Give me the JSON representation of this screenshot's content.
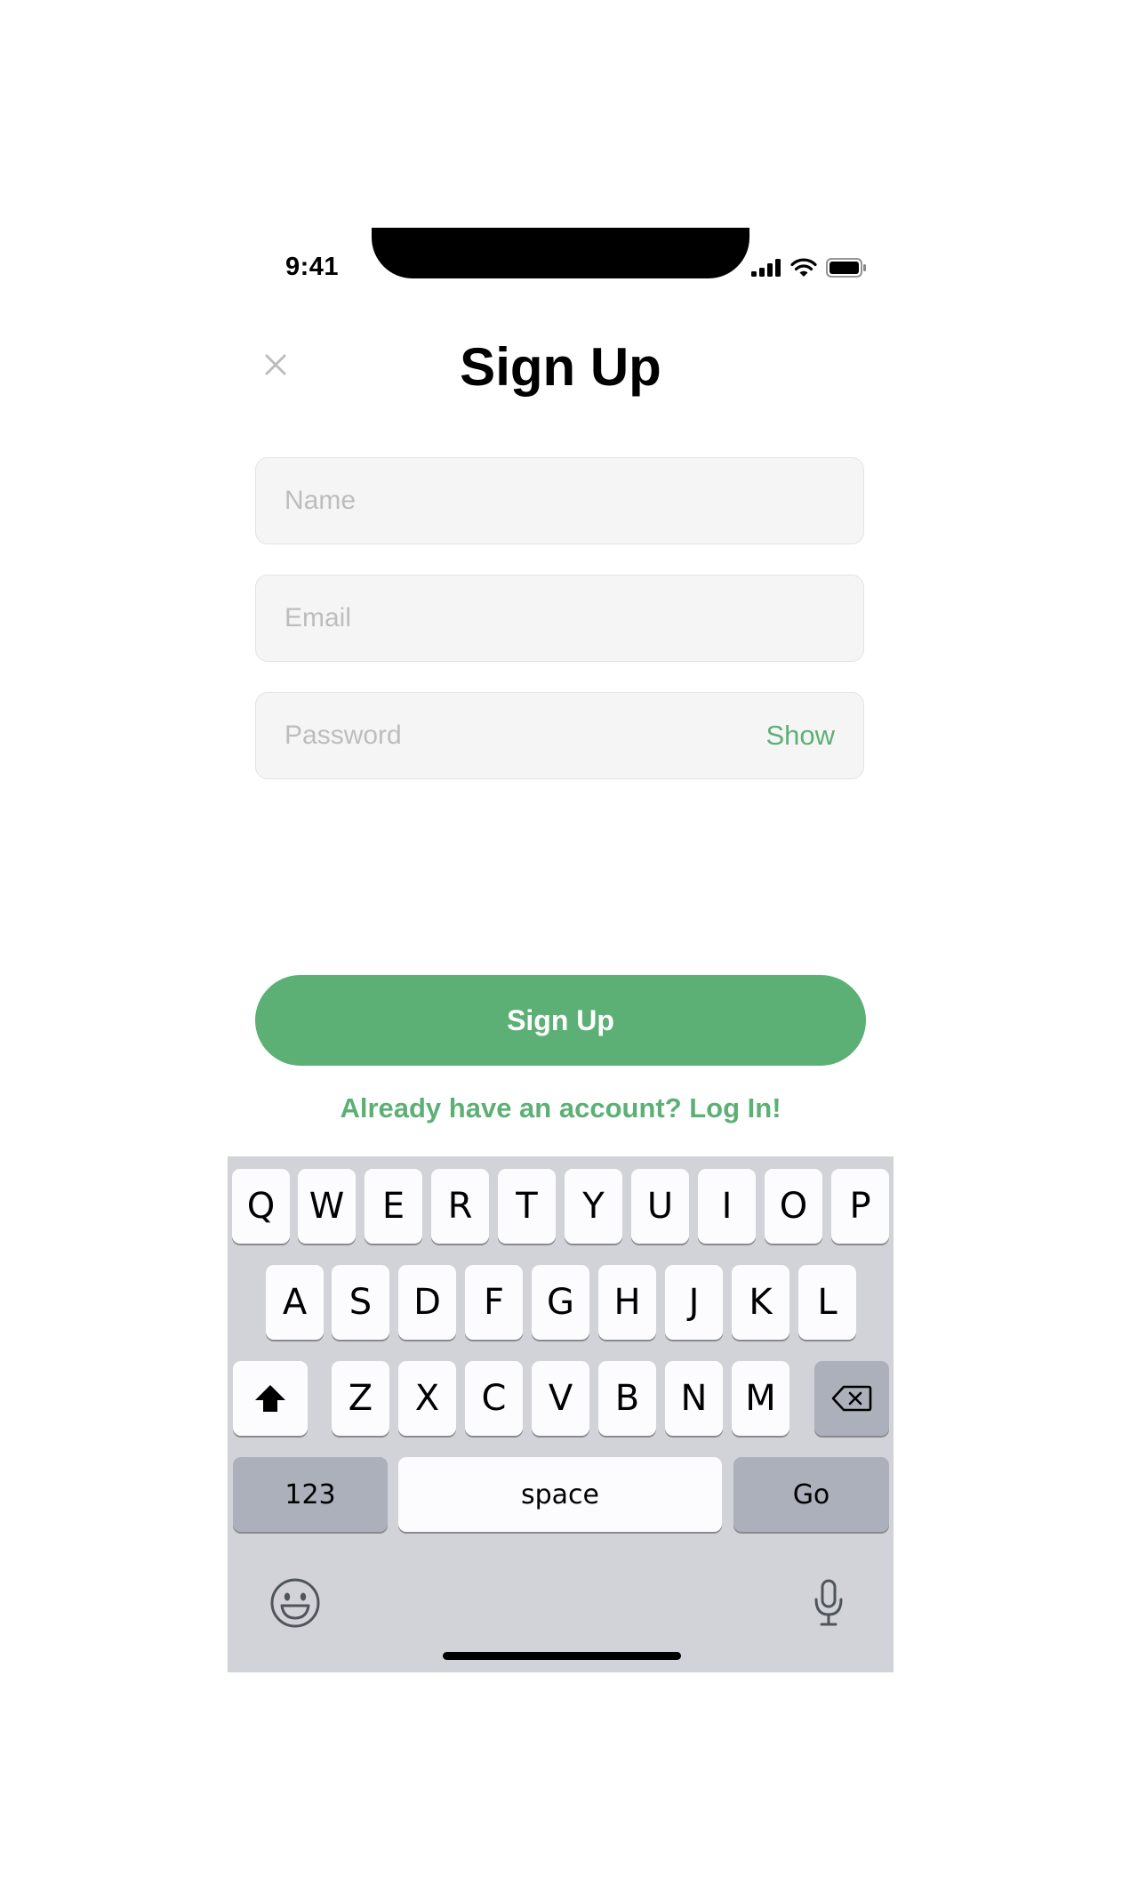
{
  "status_bar": {
    "time": "9:41"
  },
  "header": {
    "title": "Sign Up",
    "close_icon": "close-icon"
  },
  "form": {
    "name_placeholder": "Name",
    "email_placeholder": "Email",
    "password_placeholder": "Password",
    "show_label": "Show",
    "submit_label": "Sign Up",
    "login_prompt": "Already have an account? Log In!"
  },
  "keyboard": {
    "row1": [
      "Q",
      "W",
      "E",
      "R",
      "T",
      "Y",
      "U",
      "I",
      "O",
      "P"
    ],
    "row2": [
      "A",
      "S",
      "D",
      "F",
      "G",
      "H",
      "J",
      "K",
      "L"
    ],
    "row3": [
      "Z",
      "X",
      "C",
      "V",
      "B",
      "N",
      "M"
    ],
    "numbers_label": "123",
    "space_label": "space",
    "go_label": "Go",
    "icons": [
      "shift-icon",
      "backspace-icon",
      "emoji-icon",
      "microphone-icon"
    ]
  },
  "colors": {
    "accent": "#5db075",
    "field_background": "#f5f5f5",
    "keyboard_background": "#d1d3d9"
  }
}
